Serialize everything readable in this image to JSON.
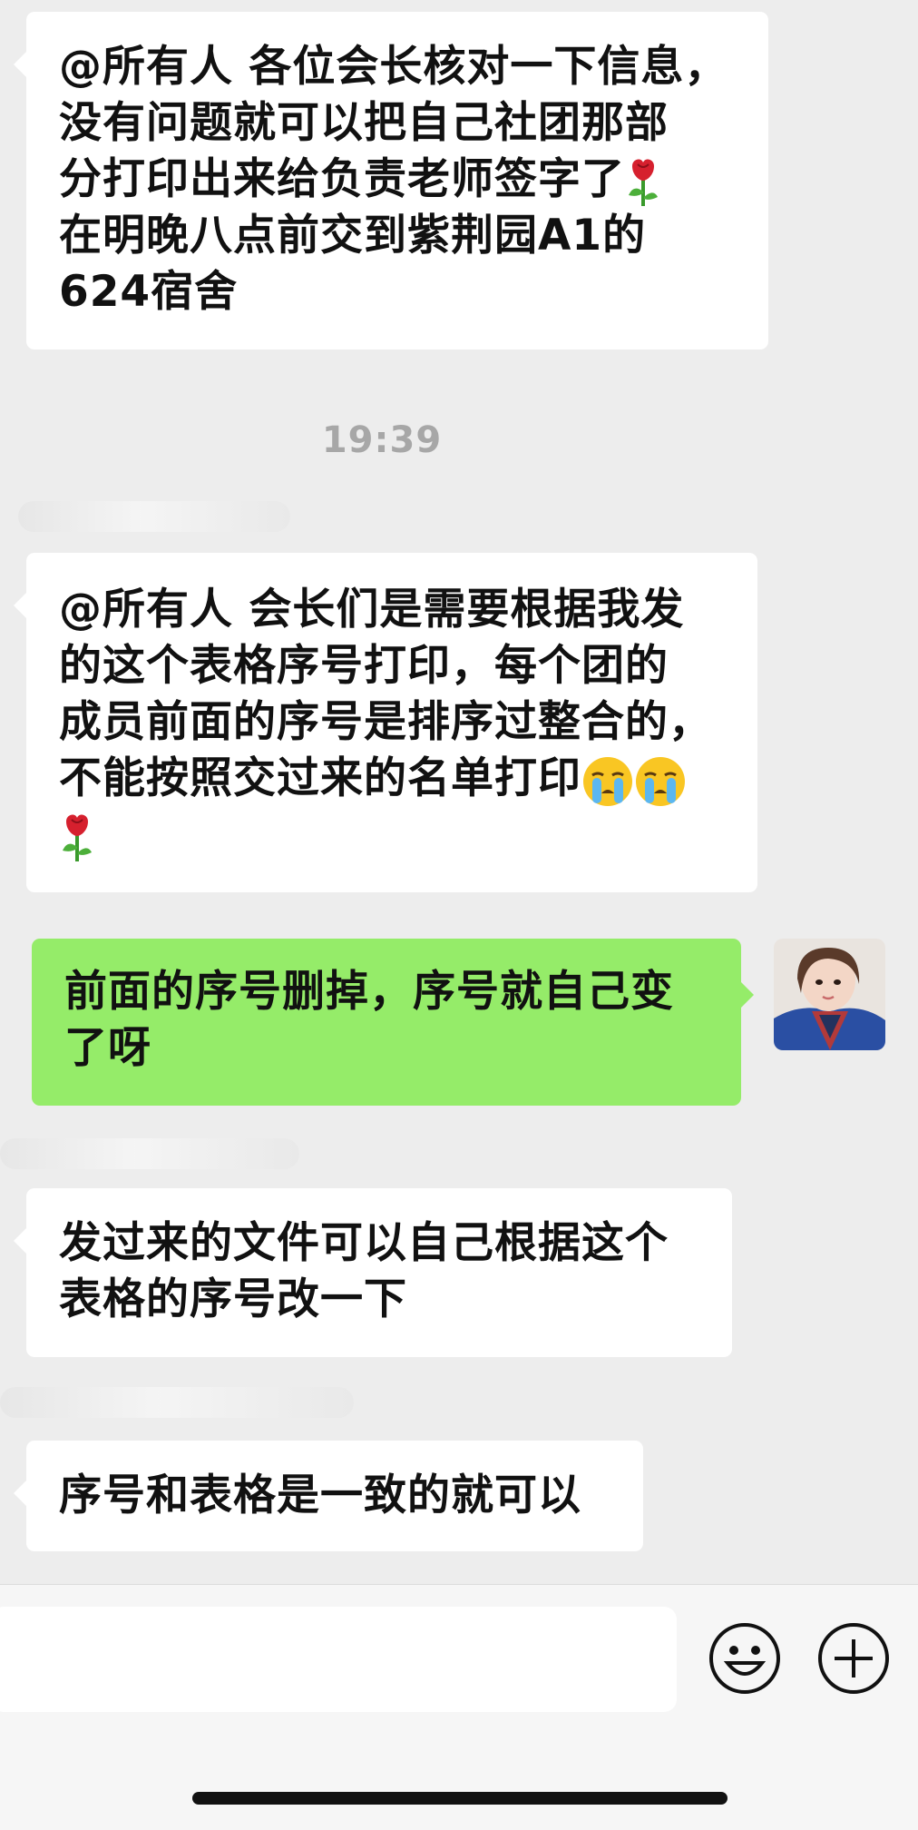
{
  "messages": [
    {
      "side": "in",
      "text": "@所有人 各位会长核对一下信息，没有问题就可以把自己社团那部分打印出来给负责老师签字了🌹在明晚八点前交到紫荆园A1的624宿舍"
    },
    {
      "side": "in",
      "text": "@所有人 会长们是需要根据我发的这个表格序号打印，每个团的成员前面的序号是排序过整合的，不能按照交过来的名单打印😭😭🌹"
    },
    {
      "side": "out",
      "text": "前面的序号删掉，序号就自己变了呀"
    },
    {
      "side": "in",
      "text": "发过来的文件可以自己根据这个表格的序号改一下"
    },
    {
      "side": "in",
      "text": "序号和表格是一致的就可以"
    }
  ],
  "msg1": {
    "lines": [
      "@所有人 各位会长核对一下信息，",
      "没有问题就可以把自己社团那部",
      "分打印出来给负责老师签字了",
      "在明晚八点前交到紫荆园A1的",
      "624宿舍"
    ]
  },
  "timestamp": "19:39",
  "msg2": {
    "lines": [
      "@所有人 会长们是需要根据我发",
      "的这个表格序号打印，每个团的",
      "成员前面的序号是排序过整合的，",
      "不能按照交过来的名单打印"
    ]
  },
  "msg3": {
    "lines": [
      "前面的序号删掉，序号就自己变",
      "了呀"
    ]
  },
  "msg4": {
    "lines": [
      "发过来的文件可以自己根据这个",
      "表格的序号改一下"
    ]
  },
  "msg5": {
    "lines": [
      "序号和表格是一致的就可以"
    ]
  },
  "icons": {
    "rose": "rose-emoji",
    "crying": "crying-face-emoji",
    "emoji_button": "smiley-face-icon",
    "more_button": "plus-circle-icon"
  },
  "colors": {
    "background": "#ededed",
    "incoming_bubble": "#ffffff",
    "outgoing_bubble": "#95ec69",
    "timestamp": "#a7a7a7"
  }
}
